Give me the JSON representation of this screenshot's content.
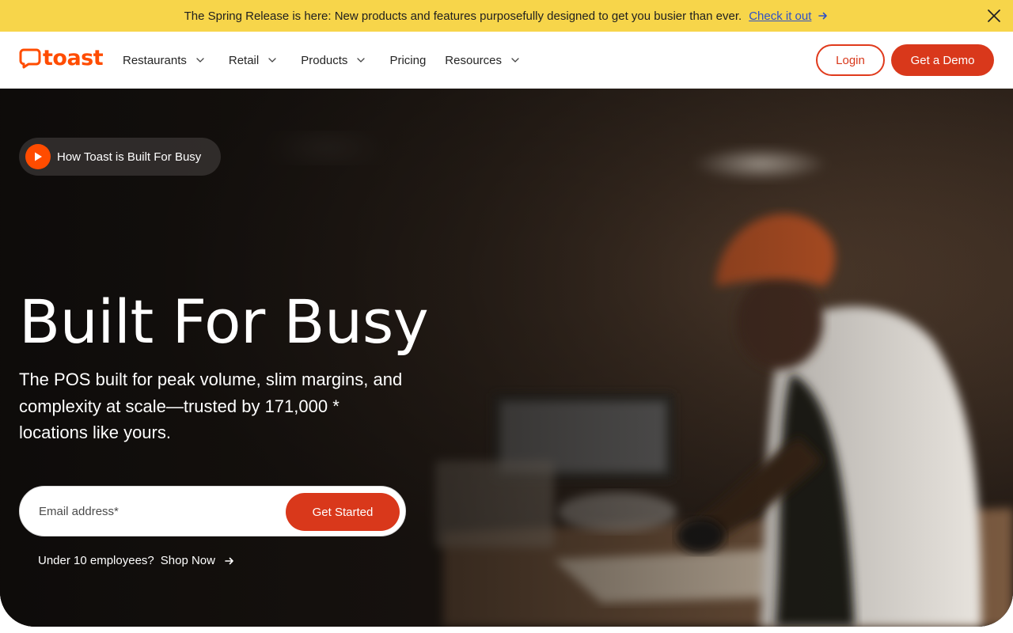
{
  "banner": {
    "message": "The Spring Release is here: New products and features purposefully designed to get you busier than ever.",
    "link_label": "Check it out",
    "link_color": "#2e51c7",
    "background": "#f7d54a"
  },
  "nav": {
    "logo_text": "toast",
    "brand_color": "#ff4c00",
    "items": [
      {
        "label": "Restaurants",
        "has_dropdown": true
      },
      {
        "label": "Retail",
        "has_dropdown": true
      },
      {
        "label": "Products",
        "has_dropdown": true
      },
      {
        "label": "Pricing",
        "has_dropdown": false
      },
      {
        "label": "Resources",
        "has_dropdown": true
      }
    ],
    "login_label": "Login",
    "demo_label": "Get a Demo",
    "button_color": "#d9381b"
  },
  "hero": {
    "video_label": "How Toast is Built For Busy",
    "headline": "Built For Busy",
    "subhead": "The POS built for peak volume, slim margins, and complexity at scale—trusted by 171,000 * locations like yours.",
    "email_placeholder": "Email address*",
    "cta_label": "Get Started",
    "shop_question": "Under 10 employees?",
    "shop_link": "Shop Now"
  },
  "icons": [
    "arrow-right-icon",
    "close-icon",
    "chevron-down-icon",
    "play-icon",
    "toast-logo-icon"
  ]
}
